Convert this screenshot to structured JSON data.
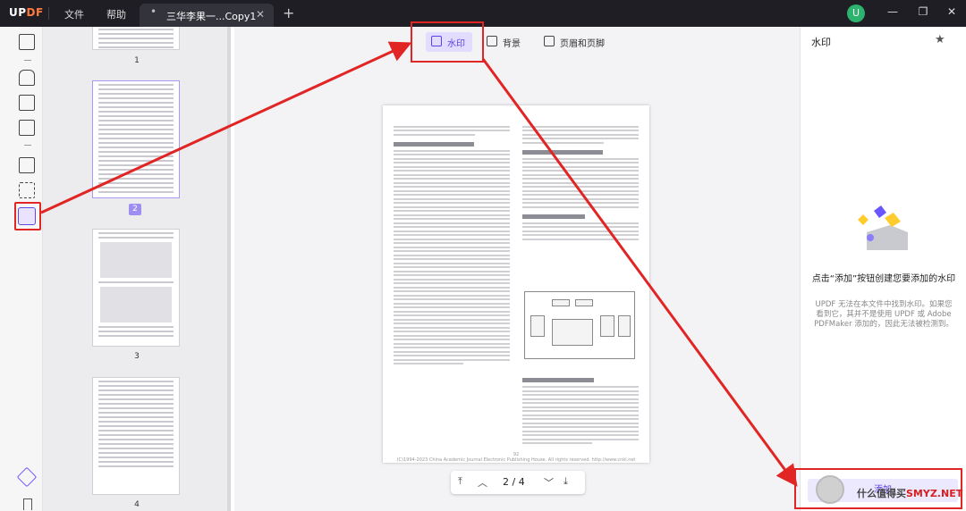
{
  "app": {
    "logo_part1": "UP",
    "logo_part2": "DF"
  },
  "menu": {
    "file": "文件",
    "help": "帮助"
  },
  "tab": {
    "dot": "•",
    "title": "三华李果一...Copy1",
    "close": "✕",
    "new": "+"
  },
  "user": {
    "avatar_letter": "U"
  },
  "window": {
    "minimize": "—",
    "restore": "❐",
    "close": "✕"
  },
  "thumbnails": [
    {
      "label": "1"
    },
    {
      "label": "2",
      "selected": true
    },
    {
      "label": "3"
    },
    {
      "label": "4"
    }
  ],
  "toolbar": {
    "watermark": "水印",
    "background": "背景",
    "header_footer": "页眉和页脚"
  },
  "page": {
    "col1_heading": "2 三华李果剥孔原理和剥孔机构结构分析",
    "col2_heading1": "3 三华李果品加工一体化设备的设计",
    "col2_heading2": "3.1 三华李果品一体化设备的整体设计",
    "col2_heading3": "3.2 三华李果剥皮处理模块装置",
    "page_number": "92",
    "footer": "(C)1994-2023 China Academic Journal Electronic Publishing House. All rights reserved. http://www.cnki.net"
  },
  "navigation": {
    "first": "⤒",
    "prev": "︿",
    "current": "2",
    "separator": "/",
    "total": "4",
    "next": "﹀",
    "last": "⤓"
  },
  "right_panel": {
    "title": "水印",
    "heading": "点击“添加”按钮创建您要添加的水印",
    "description": "UPDF 无法在本文件中找到水印。如果您看到它，其并不是使用 UPDF 或 Adobe PDFMaker 添加的，因此无法被检测到。",
    "add_button": "添加"
  },
  "site_watermark": {
    "brand_a": "什么值得买",
    "brand_b": "SMYZ.NET"
  },
  "colors": {
    "accent": "#5a43e3",
    "highlight_red": "#e12424",
    "titlebar": "#1e1e24"
  }
}
